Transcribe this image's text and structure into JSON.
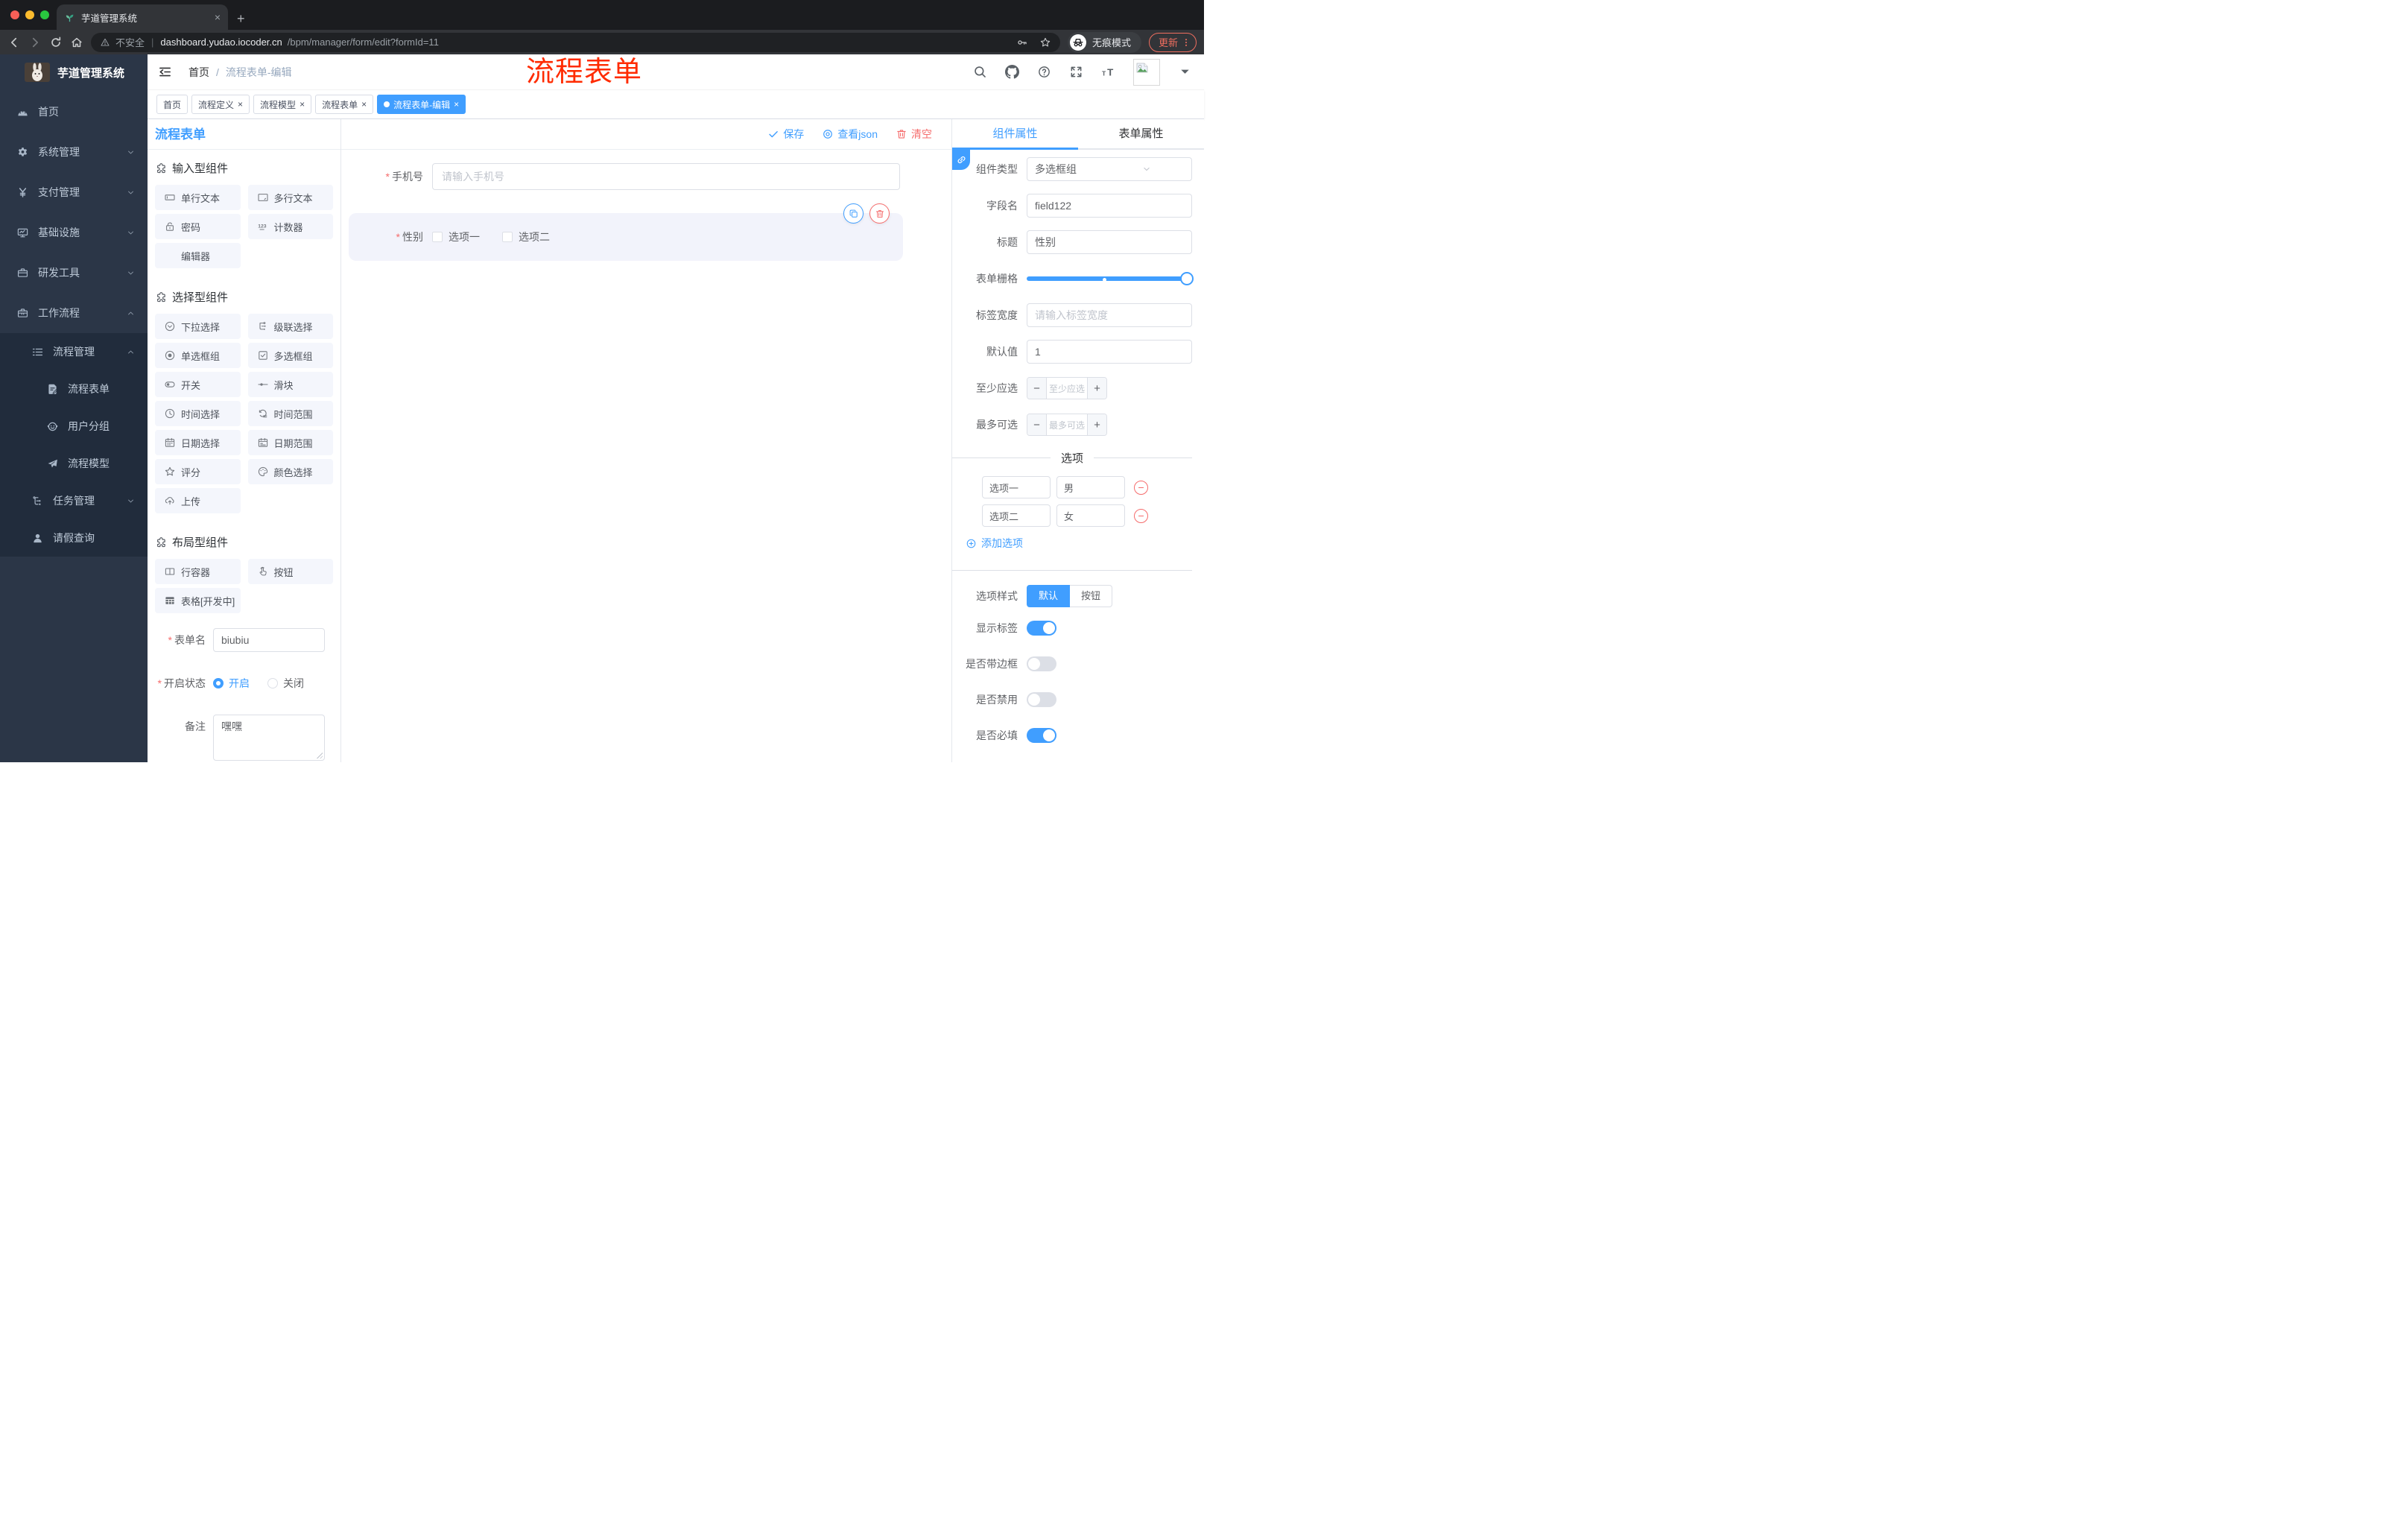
{
  "browser": {
    "tab_title": "芋道管理系统",
    "new_tab": "+",
    "close_tab": "×",
    "security_label": "不安全",
    "url_separator": "|",
    "url_domain": "dashboard.yudao.iocoder.cn",
    "url_path": "/bpm/manager/form/edit?formId=11",
    "incognito_label": "无痕模式",
    "update_label": "更新"
  },
  "sidebar": {
    "logo_title": "芋道管理系统",
    "items": [
      {
        "label": "首页",
        "icon": "dashboard-icon",
        "level": 1,
        "sub": false,
        "chevron": null
      },
      {
        "label": "系统管理",
        "icon": "gear-icon",
        "level": 1,
        "sub": false,
        "chevron": "down"
      },
      {
        "label": "支付管理",
        "icon": "yen-icon",
        "level": 1,
        "sub": false,
        "chevron": "down"
      },
      {
        "label": "基础设施",
        "icon": "monitor-icon",
        "level": 1,
        "sub": false,
        "chevron": "down"
      },
      {
        "label": "研发工具",
        "icon": "toolbox-icon",
        "level": 1,
        "sub": false,
        "chevron": "down"
      },
      {
        "label": "工作流程",
        "icon": "briefcase-icon",
        "level": 1,
        "sub": false,
        "chevron": "up"
      },
      {
        "label": "流程管理",
        "icon": "list-icon",
        "level": 2,
        "sub": true,
        "chevron": "up"
      },
      {
        "label": "流程表单",
        "icon": "document-edit-icon",
        "level": 3,
        "sub": true,
        "chevron": null
      },
      {
        "label": "用户分组",
        "icon": "user-group-icon",
        "level": 3,
        "sub": true,
        "chevron": null
      },
      {
        "label": "流程模型",
        "icon": "paper-plane-icon",
        "level": 3,
        "sub": true,
        "chevron": null
      },
      {
        "label": "任务管理",
        "icon": "task-tree-icon",
        "level": 2,
        "sub": true,
        "chevron": "down"
      },
      {
        "label": "请假查询",
        "icon": "person-icon",
        "level": 2,
        "sub": true,
        "chevron": null
      }
    ]
  },
  "header": {
    "breadcrumb_home": "首页",
    "breadcrumb_sep": "/",
    "breadcrumb_current": "流程表单-编辑",
    "annotation": "流程表单"
  },
  "page_tabs": [
    {
      "label": "首页",
      "closable": false,
      "active": false
    },
    {
      "label": "流程定义",
      "closable": true,
      "active": false
    },
    {
      "label": "流程模型",
      "closable": true,
      "active": false
    },
    {
      "label": "流程表单",
      "closable": true,
      "active": false
    },
    {
      "label": "流程表单-编辑",
      "closable": true,
      "active": true
    }
  ],
  "builder": {
    "panel_title": "流程表单",
    "sections": [
      {
        "title": "输入型组件",
        "items": [
          {
            "label": "单行文本",
            "icon": "input-icon"
          },
          {
            "label": "多行文本",
            "icon": "textarea-icon"
          },
          {
            "label": "密码",
            "icon": "lock-icon"
          },
          {
            "label": "计数器",
            "icon": "counter-icon"
          },
          {
            "label": "编辑器",
            "icon": null
          }
        ]
      },
      {
        "title": "选择型组件",
        "items": [
          {
            "label": "下拉选择",
            "icon": "select-icon"
          },
          {
            "label": "级联选择",
            "icon": "cascader-icon"
          },
          {
            "label": "单选框组",
            "icon": "radio-icon"
          },
          {
            "label": "多选框组",
            "icon": "checkbox-icon"
          },
          {
            "label": "开关",
            "icon": "switch-icon"
          },
          {
            "label": "滑块",
            "icon": "slider-icon"
          },
          {
            "label": "时间选择",
            "icon": "time-icon"
          },
          {
            "label": "时间范围",
            "icon": "time-range-icon"
          },
          {
            "label": "日期选择",
            "icon": "date-icon"
          },
          {
            "label": "日期范围",
            "icon": "date-range-icon"
          },
          {
            "label": "评分",
            "icon": "star-icon"
          },
          {
            "label": "颜色选择",
            "icon": "palette-icon"
          },
          {
            "label": "上传",
            "icon": "upload-icon"
          }
        ]
      },
      {
        "title": "布局型组件",
        "items": [
          {
            "label": "行容器",
            "icon": "row-icon"
          },
          {
            "label": "按钮",
            "icon": "button-icon"
          },
          {
            "label": "表格[开发中]",
            "icon": "table-icon"
          }
        ]
      }
    ],
    "footer": {
      "form_name_label": "表单名",
      "form_name_value": "biubiu",
      "status_label": "开启状态",
      "status_options": [
        {
          "label": "开启",
          "selected": true
        },
        {
          "label": "关闭",
          "selected": false
        }
      ],
      "remark_label": "备注",
      "remark_value": "嘿嘿"
    }
  },
  "canvas": {
    "toolbar": {
      "save": "保存",
      "view_json": "查看json",
      "clear": "清空"
    },
    "phone": {
      "label": "手机号",
      "placeholder": "请输入手机号",
      "required": true
    },
    "gender": {
      "label": "性别",
      "required": true,
      "options": [
        "选项一",
        "选项二"
      ],
      "selected": true
    }
  },
  "inspector": {
    "tab_component": "组件属性",
    "tab_form": "表单属性",
    "rows": [
      {
        "label": "组件类型",
        "type": "select",
        "value": "多选框组"
      },
      {
        "label": "字段名",
        "type": "input",
        "value": "field122"
      },
      {
        "label": "标题",
        "type": "input",
        "value": "性别"
      },
      {
        "label": "表单栅格",
        "type": "slider",
        "value": 24,
        "mark": 12
      },
      {
        "label": "标签宽度",
        "type": "input",
        "placeholder": "请输入标签宽度"
      },
      {
        "label": "默认值",
        "type": "input",
        "value": "1"
      },
      {
        "label": "至少应选",
        "type": "stepper",
        "placeholder": "至少应选"
      },
      {
        "label": "最多可选",
        "type": "stepper",
        "placeholder": "最多可选"
      }
    ],
    "options_title": "选项",
    "options": [
      {
        "label": "选项一",
        "value": "男"
      },
      {
        "label": "选项二",
        "value": "女"
      }
    ],
    "add_option": "添加选项",
    "style_row": {
      "label": "选项样式",
      "choices": [
        "默认",
        "按钮"
      ],
      "active_index": 0
    },
    "switches": [
      {
        "label": "显示标签",
        "on": true
      },
      {
        "label": "是否带边框",
        "on": false
      },
      {
        "label": "是否禁用",
        "on": false
      },
      {
        "label": "是否必填",
        "on": true
      }
    ]
  },
  "colors": {
    "primary": "#409eff",
    "danger": "#f56c6c",
    "annotation_red": "#ff2b00",
    "sidebar_bg": "#2b3647",
    "submenu_bg": "#212c3c"
  }
}
